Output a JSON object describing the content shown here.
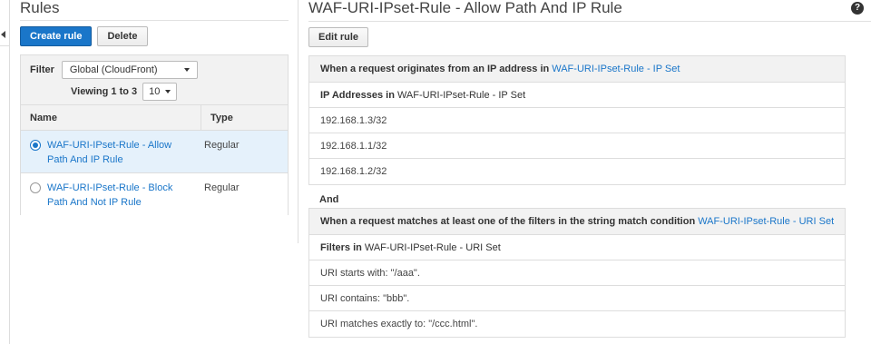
{
  "rules_panel": {
    "title": "Rules",
    "create_label": "Create rule",
    "delete_label": "Delete",
    "filter_label": "Filter",
    "filter_value": "Global (CloudFront)",
    "viewing_text": "Viewing 1 to 3",
    "page_size": "10",
    "columns": [
      "Name",
      "Type"
    ],
    "rows": [
      {
        "name": "WAF-URI-IPset-Rule - Allow Path And IP Rule",
        "type": "Regular",
        "selected": true
      },
      {
        "name": "WAF-URI-IPset-Rule - Block Path And Not IP Rule",
        "type": "Regular",
        "selected": false
      }
    ]
  },
  "detail": {
    "title": "WAF-URI-IPset-Rule - Allow Path And IP Rule",
    "edit_label": "Edit rule",
    "ip_condition": {
      "header_text": "When a request originates from an IP address in",
      "header_link": "WAF-URI-IPset-Rule - IP Set",
      "sub_bold": "IP Addresses in",
      "sub_text": "WAF-URI-IPset-Rule - IP Set",
      "items": [
        "192.168.1.3/32",
        "192.168.1.1/32",
        "192.168.1.2/32"
      ]
    },
    "and_label": "And",
    "string_condition": {
      "header_text": "When a request matches at least one of the filters in the string match condition",
      "header_link": "WAF-URI-IPset-Rule - URI Set",
      "sub_bold": "Filters in",
      "sub_text": "WAF-URI-IPset-Rule - URI Set",
      "items": [
        "URI starts with: \"/aaa\".",
        "URI contains: \"bbb\".",
        "URI matches exactly to: \"/ccc.html\"."
      ]
    }
  },
  "colors": {
    "link": "#1a76c9",
    "primary": "#1a76c9",
    "header_bg": "#f2f2f2",
    "selected_row": "#e5f1fb"
  },
  "icons": {
    "help": "help-icon",
    "collapse": "collapse-left-icon"
  }
}
